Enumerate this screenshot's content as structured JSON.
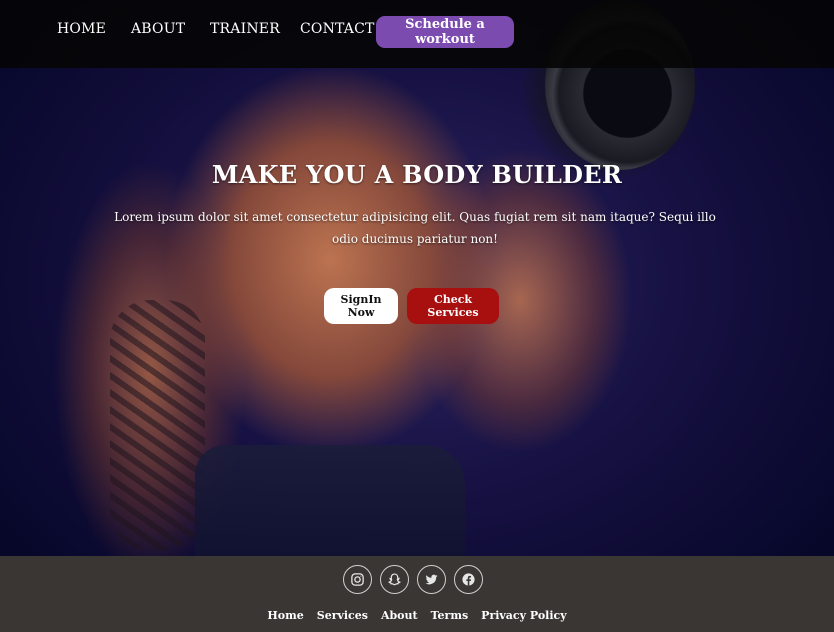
{
  "nav": {
    "links": [
      {
        "label": "HOME"
      },
      {
        "label": "ABOUT"
      },
      {
        "label": "TRAINER"
      },
      {
        "label": "CONTACT"
      }
    ],
    "cta_label": "Schedule a workout"
  },
  "hero": {
    "title": "MAKE YOU A BODY BUILDER",
    "text": "Lorem ipsum dolor sit amet consectetur adipisicing elit. Quas fugiat rem sit nam itaque? Sequi illo odio ducimus pariatur non!",
    "signin_label": "SignIn Now",
    "services_label": "Check Services"
  },
  "footer": {
    "social_icons": [
      "instagram-icon",
      "snapchat-icon",
      "twitter-icon",
      "facebook-icon"
    ],
    "links": [
      {
        "label": "Home"
      },
      {
        "label": "Services"
      },
      {
        "label": "About"
      },
      {
        "label": "Terms"
      },
      {
        "label": "Privacy Policy"
      }
    ]
  },
  "colors": {
    "nav_background": "#050505",
    "cta_purple": "#7b4bb0",
    "services_red": "#a80f0f",
    "footer_background": "#3a3633",
    "hero_navy": "#151040"
  }
}
